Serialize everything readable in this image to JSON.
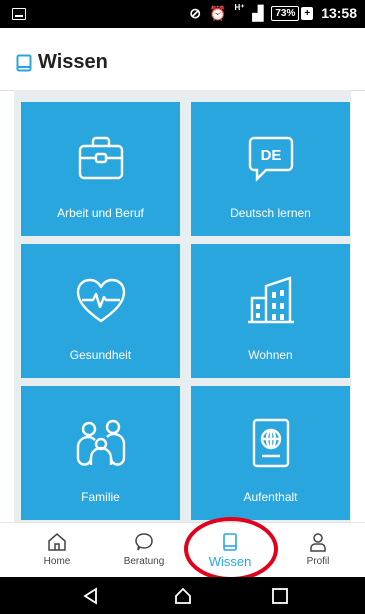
{
  "status_bar": {
    "battery": "73%",
    "time": "13:58",
    "network": "H⁺"
  },
  "header": {
    "title": "Wissen"
  },
  "tiles": [
    {
      "label": "Arbeit und Beruf",
      "icon": "briefcase-icon"
    },
    {
      "label": "Deutsch lernen",
      "icon": "speech-bubble-de-icon",
      "icon_text": "DE"
    },
    {
      "label": "Gesundheit",
      "icon": "heart-pulse-icon"
    },
    {
      "label": "Wohnen",
      "icon": "building-icon"
    },
    {
      "label": "Familie",
      "icon": "family-icon"
    },
    {
      "label": "Aufenthalt",
      "icon": "passport-icon"
    }
  ],
  "bottom_nav": [
    {
      "label": "Home",
      "icon": "home-icon"
    },
    {
      "label": "Beratung",
      "icon": "chat-bubble-icon"
    },
    {
      "label": "Wissen",
      "icon": "book-icon",
      "active": true
    },
    {
      "label": "Profil",
      "icon": "person-icon"
    }
  ],
  "colors": {
    "accent": "#2aa6df",
    "highlight": "#e2001a"
  }
}
